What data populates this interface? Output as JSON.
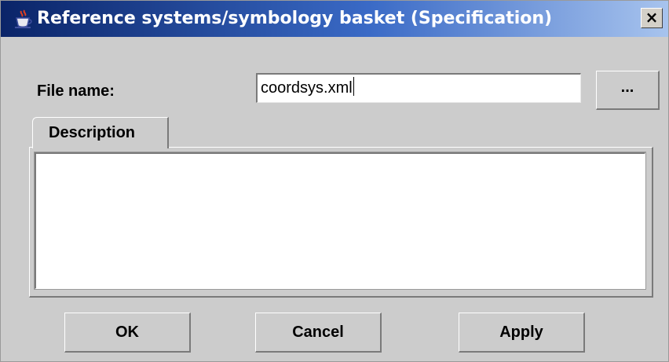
{
  "window": {
    "title": "Reference systems/symbology basket (Specification)",
    "app_icon": "java-coffee-cup-icon",
    "close_label": "×"
  },
  "form": {
    "file_name_label": "File name:",
    "file_name_value": "coordsys.xml",
    "browse_label": "...",
    "description_tab": "Description",
    "description_value": ""
  },
  "buttons": {
    "ok": "OK",
    "cancel": "Cancel",
    "apply": "Apply"
  },
  "colors": {
    "titlebar_start": "#0a2468",
    "titlebar_end": "#a8c4ee",
    "dialog_bg": "#cccccc"
  }
}
